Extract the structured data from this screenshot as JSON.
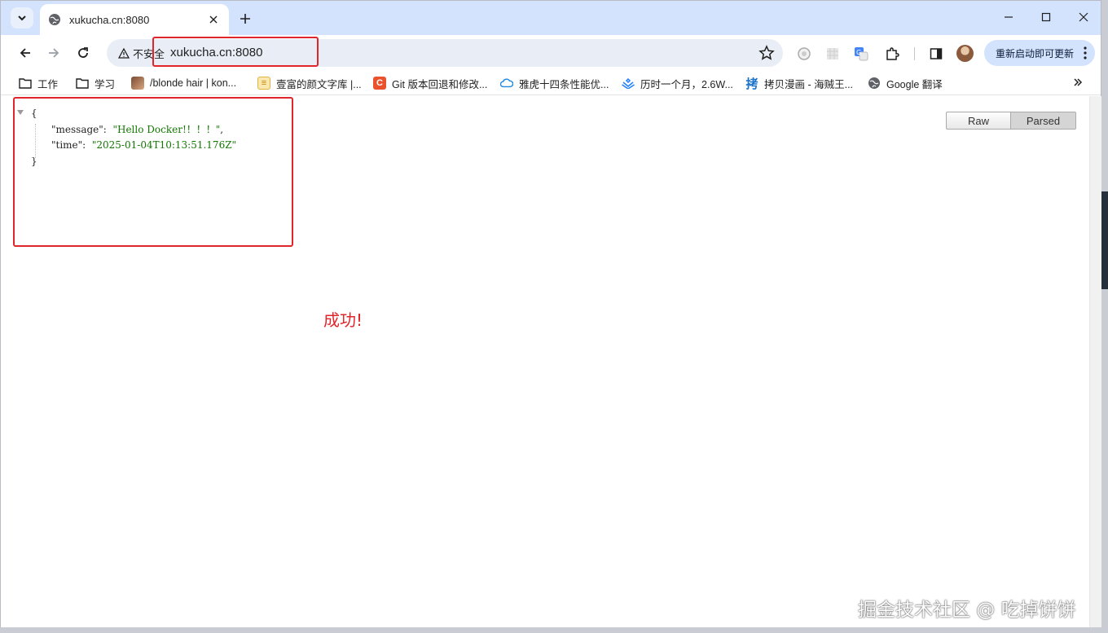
{
  "tab": {
    "title": "xukucha.cn:8080"
  },
  "omnibox": {
    "security_label": "不安全",
    "url": "xukucha.cn:8080"
  },
  "toolbar": {
    "update_label": "重新启动即可更新"
  },
  "bookmarks": [
    {
      "label": "工作",
      "icon": "folder-icon"
    },
    {
      "label": "学习",
      "icon": "folder-icon"
    },
    {
      "label": "/blonde hair | kon...",
      "icon": "image-favicon"
    },
    {
      "label": "壹富的颜文字库 |...",
      "icon": "page-favicon"
    },
    {
      "label": "Git 版本回退和修改...",
      "icon": "csdn-favicon"
    },
    {
      "label": "雅虎十四条性能优...",
      "icon": "cloud-favicon"
    },
    {
      "label": "历时一个月，2.6W...",
      "icon": "juejin-favicon"
    },
    {
      "label": "拷贝漫画 - 海贼王...",
      "icon": "copymanga-favicon"
    },
    {
      "label": "Google 翻译",
      "icon": "globe-icon"
    }
  ],
  "json_view": {
    "open_brace": "{",
    "close_brace": "}",
    "entries": [
      {
        "key": "\"message\":",
        "value": "\"Hello Docker!！！！\"",
        "suffix": ","
      },
      {
        "key": "\"time\":",
        "value": "\"2025-01-04T10:13:51.176Z\"",
        "suffix": ""
      }
    ],
    "raw_label": "Raw",
    "parsed_label": "Parsed"
  },
  "annotation": {
    "text": "成功!",
    "color": "#e0262a"
  },
  "watermark": "掘金技术社区 @ 吃掉饼饼"
}
